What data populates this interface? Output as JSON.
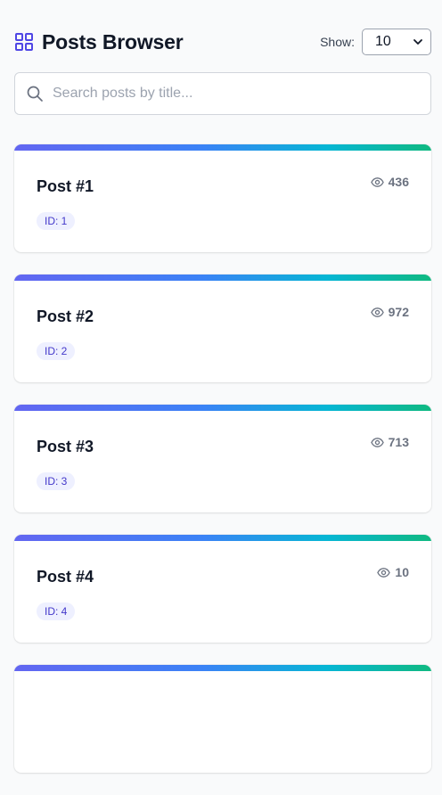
{
  "header": {
    "title": "Posts Browser",
    "icon": "grid-icon",
    "show_label": "Show:",
    "page_size_selected": "10"
  },
  "search": {
    "placeholder": "Search posts by title...",
    "value": ""
  },
  "posts": [
    {
      "title": "Post #1",
      "views": "436",
      "id_badge": "ID: 1"
    },
    {
      "title": "Post #2",
      "views": "972",
      "id_badge": "ID: 2"
    },
    {
      "title": "Post #3",
      "views": "713",
      "id_badge": "ID: 3"
    },
    {
      "title": "Post #4",
      "views": "10",
      "id_badge": "ID: 4"
    },
    {
      "title": "",
      "views": "",
      "id_badge": ""
    }
  ],
  "colors": {
    "accent": "#4f46e5",
    "gradient_start": "#6366f1",
    "gradient_end": "#10b981",
    "badge_bg": "#eef0ff",
    "badge_text": "#4338ca"
  }
}
